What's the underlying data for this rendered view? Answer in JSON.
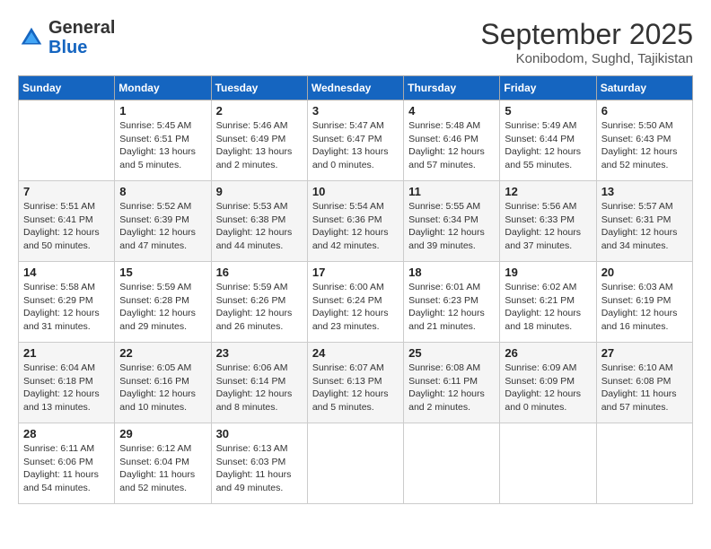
{
  "header": {
    "logo_general": "General",
    "logo_blue": "Blue",
    "month_title": "September 2025",
    "location": "Konibodom, Sughd, Tajikistan"
  },
  "days_of_week": [
    "Sunday",
    "Monday",
    "Tuesday",
    "Wednesday",
    "Thursday",
    "Friday",
    "Saturday"
  ],
  "weeks": [
    [
      {
        "day": "",
        "sunrise": "",
        "sunset": "",
        "daylight": ""
      },
      {
        "day": "1",
        "sunrise": "Sunrise: 5:45 AM",
        "sunset": "Sunset: 6:51 PM",
        "daylight": "Daylight: 13 hours and 5 minutes."
      },
      {
        "day": "2",
        "sunrise": "Sunrise: 5:46 AM",
        "sunset": "Sunset: 6:49 PM",
        "daylight": "Daylight: 13 hours and 2 minutes."
      },
      {
        "day": "3",
        "sunrise": "Sunrise: 5:47 AM",
        "sunset": "Sunset: 6:47 PM",
        "daylight": "Daylight: 13 hours and 0 minutes."
      },
      {
        "day": "4",
        "sunrise": "Sunrise: 5:48 AM",
        "sunset": "Sunset: 6:46 PM",
        "daylight": "Daylight: 12 hours and 57 minutes."
      },
      {
        "day": "5",
        "sunrise": "Sunrise: 5:49 AM",
        "sunset": "Sunset: 6:44 PM",
        "daylight": "Daylight: 12 hours and 55 minutes."
      },
      {
        "day": "6",
        "sunrise": "Sunrise: 5:50 AM",
        "sunset": "Sunset: 6:43 PM",
        "daylight": "Daylight: 12 hours and 52 minutes."
      }
    ],
    [
      {
        "day": "7",
        "sunrise": "Sunrise: 5:51 AM",
        "sunset": "Sunset: 6:41 PM",
        "daylight": "Daylight: 12 hours and 50 minutes."
      },
      {
        "day": "8",
        "sunrise": "Sunrise: 5:52 AM",
        "sunset": "Sunset: 6:39 PM",
        "daylight": "Daylight: 12 hours and 47 minutes."
      },
      {
        "day": "9",
        "sunrise": "Sunrise: 5:53 AM",
        "sunset": "Sunset: 6:38 PM",
        "daylight": "Daylight: 12 hours and 44 minutes."
      },
      {
        "day": "10",
        "sunrise": "Sunrise: 5:54 AM",
        "sunset": "Sunset: 6:36 PM",
        "daylight": "Daylight: 12 hours and 42 minutes."
      },
      {
        "day": "11",
        "sunrise": "Sunrise: 5:55 AM",
        "sunset": "Sunset: 6:34 PM",
        "daylight": "Daylight: 12 hours and 39 minutes."
      },
      {
        "day": "12",
        "sunrise": "Sunrise: 5:56 AM",
        "sunset": "Sunset: 6:33 PM",
        "daylight": "Daylight: 12 hours and 37 minutes."
      },
      {
        "day": "13",
        "sunrise": "Sunrise: 5:57 AM",
        "sunset": "Sunset: 6:31 PM",
        "daylight": "Daylight: 12 hours and 34 minutes."
      }
    ],
    [
      {
        "day": "14",
        "sunrise": "Sunrise: 5:58 AM",
        "sunset": "Sunset: 6:29 PM",
        "daylight": "Daylight: 12 hours and 31 minutes."
      },
      {
        "day": "15",
        "sunrise": "Sunrise: 5:59 AM",
        "sunset": "Sunset: 6:28 PM",
        "daylight": "Daylight: 12 hours and 29 minutes."
      },
      {
        "day": "16",
        "sunrise": "Sunrise: 5:59 AM",
        "sunset": "Sunset: 6:26 PM",
        "daylight": "Daylight: 12 hours and 26 minutes."
      },
      {
        "day": "17",
        "sunrise": "Sunrise: 6:00 AM",
        "sunset": "Sunset: 6:24 PM",
        "daylight": "Daylight: 12 hours and 23 minutes."
      },
      {
        "day": "18",
        "sunrise": "Sunrise: 6:01 AM",
        "sunset": "Sunset: 6:23 PM",
        "daylight": "Daylight: 12 hours and 21 minutes."
      },
      {
        "day": "19",
        "sunrise": "Sunrise: 6:02 AM",
        "sunset": "Sunset: 6:21 PM",
        "daylight": "Daylight: 12 hours and 18 minutes."
      },
      {
        "day": "20",
        "sunrise": "Sunrise: 6:03 AM",
        "sunset": "Sunset: 6:19 PM",
        "daylight": "Daylight: 12 hours and 16 minutes."
      }
    ],
    [
      {
        "day": "21",
        "sunrise": "Sunrise: 6:04 AM",
        "sunset": "Sunset: 6:18 PM",
        "daylight": "Daylight: 12 hours and 13 minutes."
      },
      {
        "day": "22",
        "sunrise": "Sunrise: 6:05 AM",
        "sunset": "Sunset: 6:16 PM",
        "daylight": "Daylight: 12 hours and 10 minutes."
      },
      {
        "day": "23",
        "sunrise": "Sunrise: 6:06 AM",
        "sunset": "Sunset: 6:14 PM",
        "daylight": "Daylight: 12 hours and 8 minutes."
      },
      {
        "day": "24",
        "sunrise": "Sunrise: 6:07 AM",
        "sunset": "Sunset: 6:13 PM",
        "daylight": "Daylight: 12 hours and 5 minutes."
      },
      {
        "day": "25",
        "sunrise": "Sunrise: 6:08 AM",
        "sunset": "Sunset: 6:11 PM",
        "daylight": "Daylight: 12 hours and 2 minutes."
      },
      {
        "day": "26",
        "sunrise": "Sunrise: 6:09 AM",
        "sunset": "Sunset: 6:09 PM",
        "daylight": "Daylight: 12 hours and 0 minutes."
      },
      {
        "day": "27",
        "sunrise": "Sunrise: 6:10 AM",
        "sunset": "Sunset: 6:08 PM",
        "daylight": "Daylight: 11 hours and 57 minutes."
      }
    ],
    [
      {
        "day": "28",
        "sunrise": "Sunrise: 6:11 AM",
        "sunset": "Sunset: 6:06 PM",
        "daylight": "Daylight: 11 hours and 54 minutes."
      },
      {
        "day": "29",
        "sunrise": "Sunrise: 6:12 AM",
        "sunset": "Sunset: 6:04 PM",
        "daylight": "Daylight: 11 hours and 52 minutes."
      },
      {
        "day": "30",
        "sunrise": "Sunrise: 6:13 AM",
        "sunset": "Sunset: 6:03 PM",
        "daylight": "Daylight: 11 hours and 49 minutes."
      },
      {
        "day": "",
        "sunrise": "",
        "sunset": "",
        "daylight": ""
      },
      {
        "day": "",
        "sunrise": "",
        "sunset": "",
        "daylight": ""
      },
      {
        "day": "",
        "sunrise": "",
        "sunset": "",
        "daylight": ""
      },
      {
        "day": "",
        "sunrise": "",
        "sunset": "",
        "daylight": ""
      }
    ]
  ]
}
